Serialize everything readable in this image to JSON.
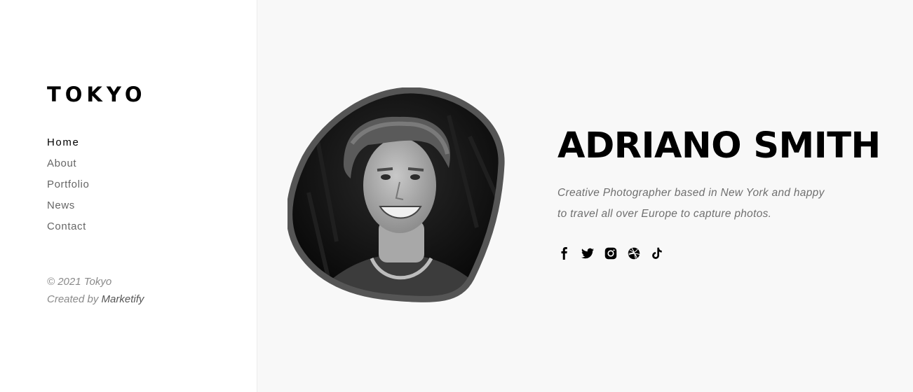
{
  "sidebar": {
    "logo": "TOKYO",
    "nav": [
      {
        "label": "Home",
        "active": true
      },
      {
        "label": "About"
      },
      {
        "label": "Portfolio"
      },
      {
        "label": "News"
      },
      {
        "label": "Contact"
      }
    ],
    "copyright": "© 2021 Tokyo",
    "created_prefix": "Created by",
    "created_author": "Marketify"
  },
  "hero": {
    "name": "ADRIANO SMITH",
    "bio_line1": "Creative Photographer based in New York and happy",
    "bio_line2": "to travel all over Europe to capture photos.",
    "avatar_icon": "profile-photo",
    "social": [
      "facebook-icon",
      "twitter-icon",
      "instagram-icon",
      "dribbble-icon",
      "tiktok-icon"
    ]
  },
  "colors": {
    "sidebar_bg": "#ffffff",
    "main_bg": "#f8f8f8",
    "text_primary": "#000000",
    "text_muted": "#666666",
    "avatar_border": "#555555"
  }
}
